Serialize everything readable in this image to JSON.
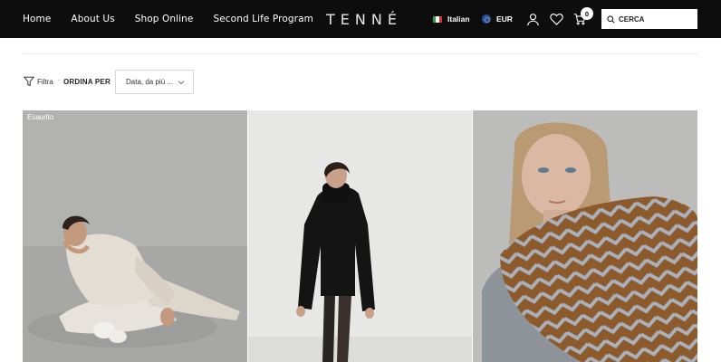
{
  "header": {
    "nav": [
      {
        "label": "Home"
      },
      {
        "label": "About Us"
      },
      {
        "label": "Shop Online"
      },
      {
        "label": "Second Life Program"
      }
    ],
    "logo": "TENNÉ",
    "language": "Italian",
    "currency": "EUR",
    "cart_count": "0",
    "search_placeholder": "CERCA"
  },
  "toolbar": {
    "filter_label": "Filtra",
    "separator": "-",
    "order_label": "ORDINA PER",
    "sort_value": "Data, da più ..."
  },
  "products": [
    {
      "badge": "Esaurito",
      "image": "model-cream-knit-sitting"
    },
    {
      "badge": "",
      "image": "model-black-turtleneck-walking"
    },
    {
      "badge": "",
      "image": "model-chevron-scarf-portrait"
    }
  ],
  "colors": {
    "header_bg": "#0d0d0d",
    "flag_italy": [
      "#2e9e4a",
      "#ffffff",
      "#d8322e"
    ]
  }
}
